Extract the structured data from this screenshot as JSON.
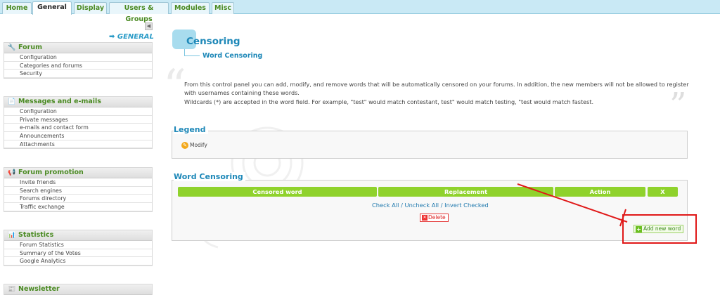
{
  "tabs": [
    {
      "label": "Home"
    },
    {
      "label": "General",
      "active": true
    },
    {
      "label": "Display"
    },
    {
      "label": "Users & Groups"
    },
    {
      "label": "Modules"
    },
    {
      "label": "Misc"
    }
  ],
  "sidebar": {
    "section_label": "➡ GENERAL",
    "collapse_glyph": "◀",
    "boxes": [
      {
        "title": "Forum",
        "icon": "wrench-icon",
        "items": [
          "Configuration",
          "Categories and forums",
          "Security"
        ]
      },
      {
        "title": "Messages and e-mails",
        "icon": "document-icon",
        "items": [
          "Configuration",
          "Private messages",
          "e-mails and contact form",
          "Announcements",
          "Attachments"
        ]
      },
      {
        "title": "Forum promotion",
        "icon": "megaphone-icon",
        "items": [
          "Invite friends",
          "Search engines",
          "Forums directory",
          "Traffic exchange"
        ]
      },
      {
        "title": "Statistics",
        "icon": "pie-chart-icon",
        "items": [
          "Forum Statistics",
          "Summary of the Votes",
          "Google Analytics"
        ]
      },
      {
        "title": "Newsletter",
        "icon": "newsletter-icon",
        "items": []
      }
    ]
  },
  "main": {
    "title": "Censoring",
    "subtitle": "Word Censoring",
    "description": [
      "From this control panel you can add, modify, and remove words that will be automatically censored on your forums. In addition, the new members will not be allowed to register",
      "with usernames containing these words.",
      "Wildcards (*) are accepted in the word field. For example, \"test\" would match contestant, test\" would match testing, \"test would match fastest."
    ],
    "legend": {
      "title": "Legend",
      "modify_label": "Modify"
    },
    "table": {
      "title": "Word Censoring",
      "columns": [
        "Censored word",
        "Replacement",
        "Action",
        "X"
      ],
      "check_all": "Check All",
      "uncheck_all": "Uncheck All",
      "invert_checked": "Invert Checked",
      "separator": " / ",
      "delete_label": "Delete",
      "add_label": "Add new word"
    }
  },
  "colors": {
    "accent_green": "#8fd22c",
    "link_blue": "#1e88b8",
    "annotation_red": "#e01818"
  }
}
